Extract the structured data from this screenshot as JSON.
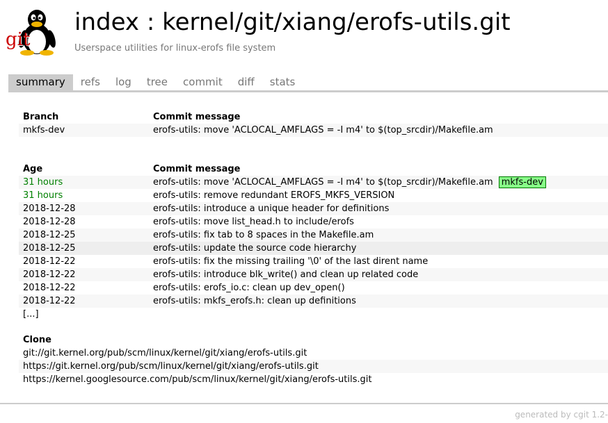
{
  "header": {
    "logo_text": "git",
    "title": "index : kernel/git/xiang/erofs-utils.git",
    "description": "Userspace utilities for linux-erofs file system"
  },
  "tabs": [
    {
      "label": "summary",
      "active": true
    },
    {
      "label": "refs",
      "active": false
    },
    {
      "label": "log",
      "active": false
    },
    {
      "label": "tree",
      "active": false
    },
    {
      "label": "commit",
      "active": false
    },
    {
      "label": "diff",
      "active": false
    },
    {
      "label": "stats",
      "active": false
    }
  ],
  "branches": {
    "col_branch": "Branch",
    "col_message": "Commit message",
    "rows": [
      {
        "branch": "mkfs-dev",
        "message": "erofs-utils: move 'ACLOCAL_AMFLAGS = -I m4' to $(top_srcdir)/Makefile.am"
      }
    ]
  },
  "log": {
    "col_age": "Age",
    "col_message": "Commit message",
    "rows": [
      {
        "age": "31 hours",
        "message": "erofs-utils: move 'ACLOCAL_AMFLAGS = -I m4' to $(top_srcdir)/Makefile.am",
        "decoration": "mkfs-dev"
      },
      {
        "age": "31 hours",
        "message": "erofs-utils: remove redundant EROFS_MKFS_VERSION"
      },
      {
        "age": "2018-12-28",
        "message": "erofs-utils: introduce a unique header for definitions"
      },
      {
        "age": "2018-12-28",
        "message": "erofs-utils: move list_head.h to include/erofs"
      },
      {
        "age": "2018-12-25",
        "message": "erofs-utils: fix tab to 8 spaces in the Makefile.am"
      },
      {
        "age": "2018-12-25",
        "message": "erofs-utils: update the source code hierarchy"
      },
      {
        "age": "2018-12-22",
        "message": "erofs-utils: fix the missing trailing '\\0' of the last dirent name"
      },
      {
        "age": "2018-12-22",
        "message": "erofs-utils: introduce blk_write() and clean up related code"
      },
      {
        "age": "2018-12-22",
        "message": "erofs-utils: erofs_io.c: clean up dev_open()"
      },
      {
        "age": "2018-12-22",
        "message": "erofs-utils: mkfs_erofs.h: clean up definitions"
      }
    ],
    "more": "[...]"
  },
  "clone": {
    "heading": "Clone",
    "urls": [
      "git://git.kernel.org/pub/scm/linux/kernel/git/xiang/erofs-utils.git",
      "https://git.kernel.org/pub/scm/linux/kernel/git/xiang/erofs-utils.git",
      "https://kernel.googlesource.com/pub/scm/linux/kernel/git/xiang/erofs-utils.git"
    ]
  },
  "footer": {
    "text": "generated by cgit 1.2-"
  },
  "colors": {
    "recent_age": "#008000",
    "decoration_bg": "#88ff88",
    "tab_active_bg": "#cccccc",
    "logo_red": "#cc0000"
  },
  "icons": {
    "logo": "tux-penguin-git-logo"
  }
}
